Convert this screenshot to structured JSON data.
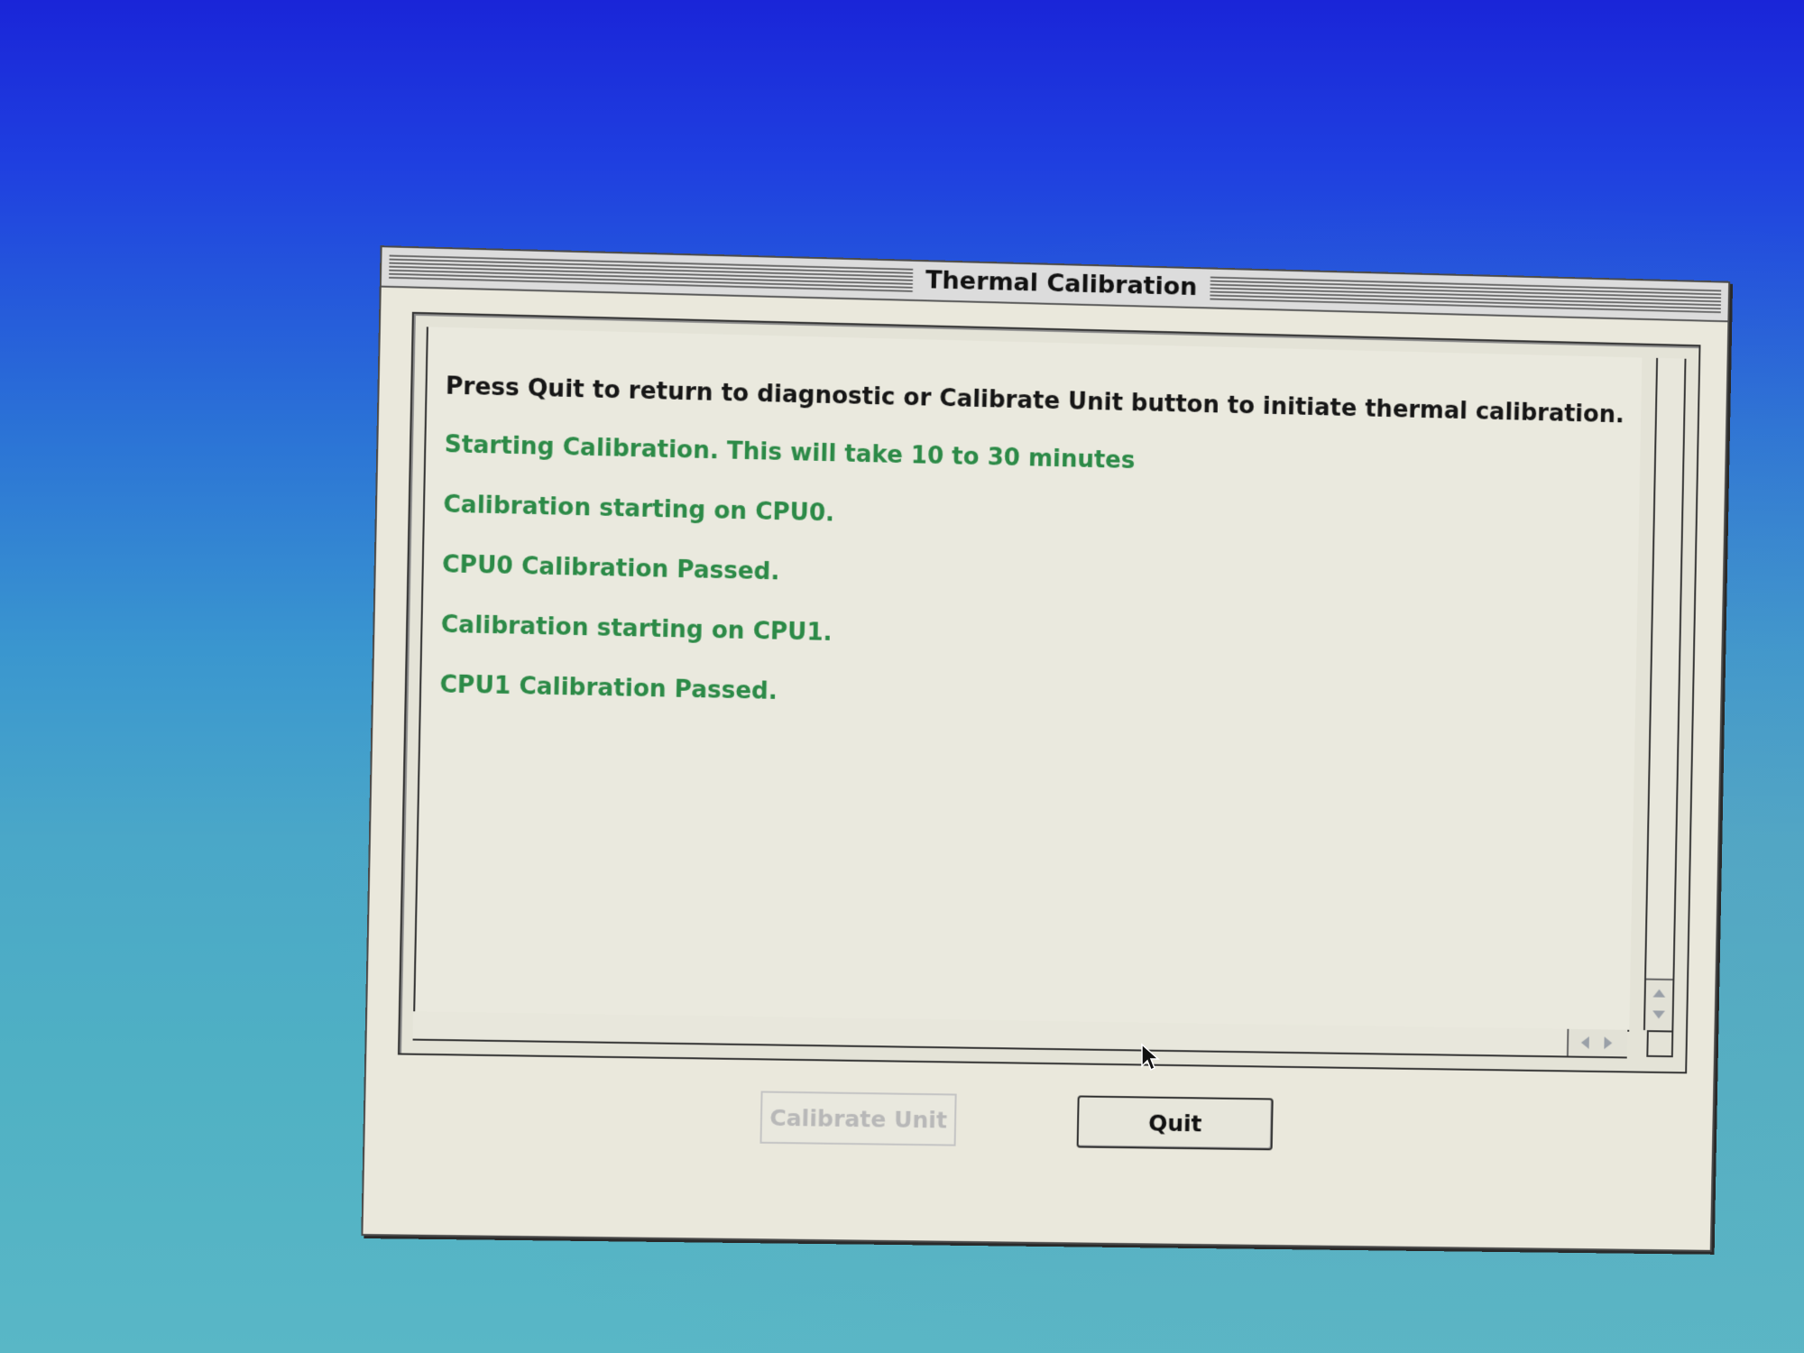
{
  "window": {
    "title": "Thermal Calibration"
  },
  "log": {
    "instruction": "Press Quit to return to diagnostic or Calibrate Unit button to initiate thermal calibration.",
    "lines": [
      "Starting Calibration. This will take 10 to 30 minutes",
      "Calibration starting on CPU0.",
      "CPU0 Calibration Passed.",
      "Calibration starting on CPU1.",
      "CPU1 Calibration Passed."
    ]
  },
  "buttons": {
    "calibrate_label": "Calibrate Unit",
    "calibrate_enabled": false,
    "quit_label": "Quit"
  },
  "colors": {
    "status_text": "#2c8a47",
    "instruction_text": "#161616",
    "desktop_top": "#1a25d8",
    "desktop_bottom": "#59b7c6",
    "window_bg": "#eae8dc"
  },
  "icons": {
    "cursor": "arrow-cursor-icon",
    "scroll_up": "scroll-up-arrow-icon",
    "scroll_down": "scroll-down-arrow-icon",
    "scroll_left": "scroll-left-arrow-icon",
    "scroll_right": "scroll-right-arrow-icon"
  }
}
